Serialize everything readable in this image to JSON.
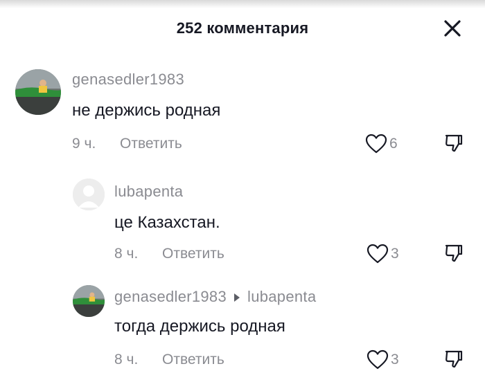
{
  "header": {
    "title": "252 комментария",
    "close_icon": "close-icon"
  },
  "comments": [
    {
      "username": "genasedler1983",
      "text": "не держись родная",
      "time": "9 ч.",
      "reply_label": "Ответить",
      "likes": "6"
    },
    {
      "username": "lubapenta",
      "text": "це Казахстан.",
      "time": "8 ч.",
      "reply_label": "Ответить",
      "likes": "3"
    },
    {
      "username": "genasedler1983",
      "reply_to": "lubapenta",
      "text": "тогда держись родная",
      "time": "8 ч.",
      "reply_label": "Ответить",
      "likes": "3"
    }
  ],
  "colors": {
    "text": "#161823",
    "secondary": "#8a8b91",
    "background": "#ffffff"
  }
}
